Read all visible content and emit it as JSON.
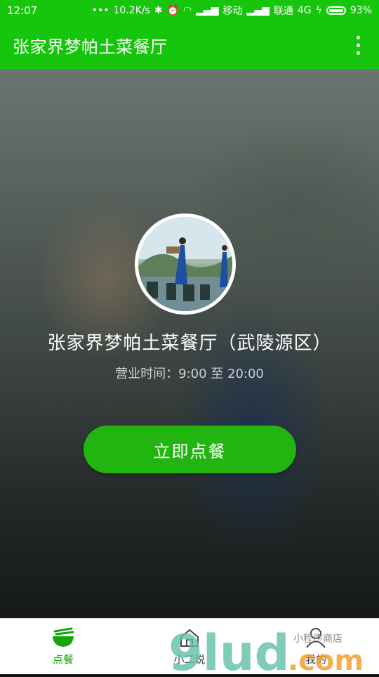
{
  "status_bar": {
    "time": "12:07",
    "speed": "10.2K/s",
    "carrier1": "移动",
    "carrier2": "联通",
    "network": "4G",
    "battery": "93%"
  },
  "appbar": {
    "title": "张家界梦帕土菜餐厅"
  },
  "restaurant": {
    "name": "张家界梦帕土菜餐厅（武陵源区）",
    "hours": "营业时间：9:00 至 20:00",
    "order_button": "立即点餐"
  },
  "tabs": [
    {
      "label": "点餐",
      "icon": "bowl-icon",
      "active": true
    },
    {
      "label": "小二说",
      "icon": "home-icon",
      "active": false
    },
    {
      "label": "我的",
      "icon": "user-icon",
      "active": false
    }
  ],
  "colors": {
    "primary": "#16c60c",
    "button": "#22b512"
  },
  "watermark": {
    "text": "9lud.com",
    "small_text": "小程序商店"
  }
}
